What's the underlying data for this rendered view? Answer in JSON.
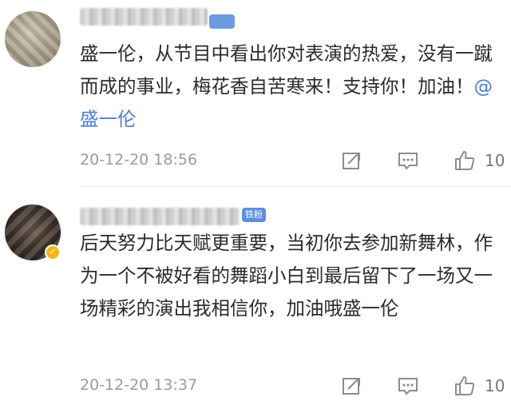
{
  "comments": [
    {
      "badge": "",
      "text": "盛一伦，从节目中看出你对表演的热爱，没有一蹴而成的事业，梅花香自苦寒来！支持你！加油！",
      "mention": "@盛一伦",
      "time": "20-12-20 18:56",
      "likes": "10"
    },
    {
      "badge": "铁粉",
      "text": "后天努力比天赋更重要，当初你去参加新舞林，作为一个不被好看的舞蹈小白到最后留下了一场又一场精彩的演出我相信你，加油哦盛一伦",
      "time": "20-12-20 13:37",
      "likes": "10"
    }
  ],
  "icons": [
    "share-icon",
    "comment-icon",
    "like-icon",
    "verified-badge-icon"
  ],
  "colors": {
    "mention": "#4d7fcf",
    "badge": "#5d8fe0",
    "verified": "#f5b71b",
    "meta": "#9b9b9b"
  }
}
